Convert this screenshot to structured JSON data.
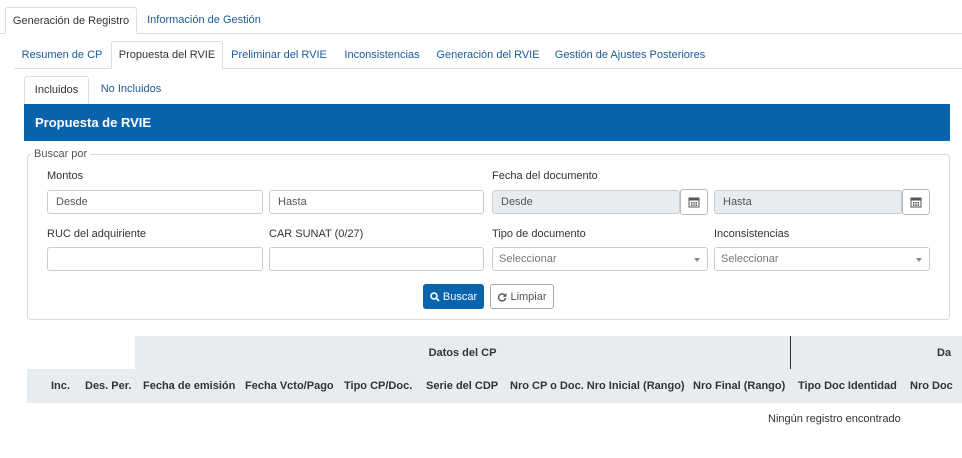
{
  "top_tabs": [
    {
      "label": "Generación de Registro",
      "active": true
    },
    {
      "label": "Información de Gestión",
      "active": false
    }
  ],
  "sub_tabs": [
    {
      "label": "Resumen de CP",
      "active": false
    },
    {
      "label": "Propuesta del RVIE",
      "active": true
    },
    {
      "label": "Preliminar del RVIE",
      "active": false
    },
    {
      "label": "Inconsistencias",
      "active": false
    },
    {
      "label": "Generación del RVIE",
      "active": false
    },
    {
      "label": "Gestión de Ajustes Posteriores",
      "active": false
    }
  ],
  "inner_tabs": [
    {
      "label": "Incluidos",
      "active": true
    },
    {
      "label": "No Incluidos",
      "active": false
    }
  ],
  "panel": {
    "title": "Propuesta de RVIE"
  },
  "search": {
    "legend": "Buscar por",
    "montos_label": "Montos",
    "montos_desde_placeholder": "Desde",
    "montos_hasta_placeholder": "Hasta",
    "fecha_label": "Fecha del documento",
    "fecha_desde_placeholder": "Desde",
    "fecha_hasta_placeholder": "Hasta",
    "ruc_label": "RUC del adquiriente",
    "car_label": "CAR SUNAT (0/27)",
    "tipo_doc_label": "Tipo de documento",
    "tipo_doc_value": "Seleccionar",
    "inconsistencias_label": "Inconsistencias",
    "inconsistencias_value": "Seleccionar",
    "buscar_label": "Buscar",
    "limpiar_label": "Limpiar"
  },
  "table": {
    "group_headers": [
      "Datos del CP",
      "Da"
    ],
    "columns": [
      "Inc.",
      "Des. Per.",
      "Fecha de emisión",
      "Fecha Vcto/Pago",
      "Tipo CP/Doc.",
      "Serie del CDP",
      "Nro CP o Doc. Nro Inicial (Rango)",
      "Nro Final (Rango)",
      "Tipo Doc Identidad",
      "Nro Doc"
    ],
    "empty_message": "Ningún registro encontrado"
  },
  "colors": {
    "primary": "#0a64ad",
    "link": "#1a5a9a",
    "header_bg": "#e9ecef"
  }
}
